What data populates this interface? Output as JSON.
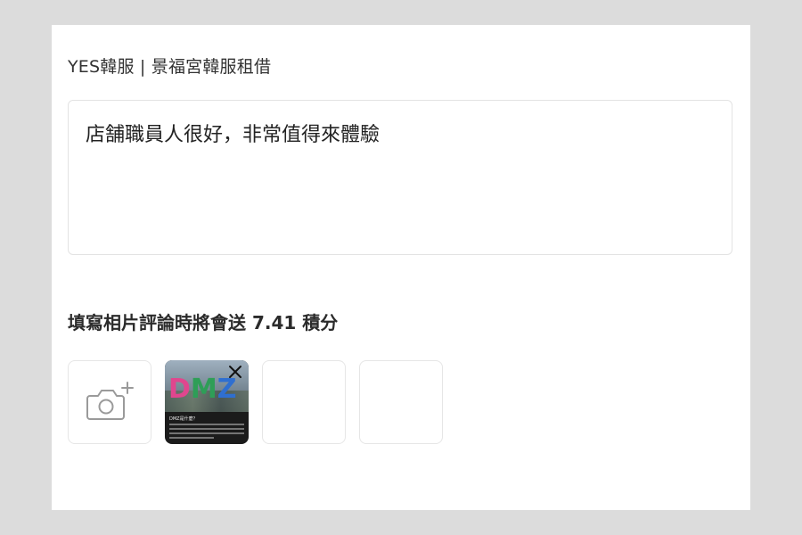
{
  "product": {
    "name": "YES韓服 | 景福宮韓服租借"
  },
  "review": {
    "text": "店舗職員人很好，非常值得來體驗"
  },
  "bonus": {
    "text": "填寫相片評論時將會送 7.41 積分"
  },
  "photos": {
    "add_icon": "camera-plus-icon",
    "uploaded": [
      {
        "logo_letters": [
          "D",
          "M",
          "Z"
        ],
        "caption": "DMZ是什麼？",
        "remove_icon": "close-icon"
      }
    ],
    "empty_slots": 2
  },
  "colors": {
    "page_bg": "#dcdcdc",
    "card_bg": "#ffffff",
    "border": "#e3e3e3",
    "text": "#222222",
    "dmz_d": "#e0468e",
    "dmz_m": "#2e9e57",
    "dmz_z": "#2f6fd0"
  }
}
